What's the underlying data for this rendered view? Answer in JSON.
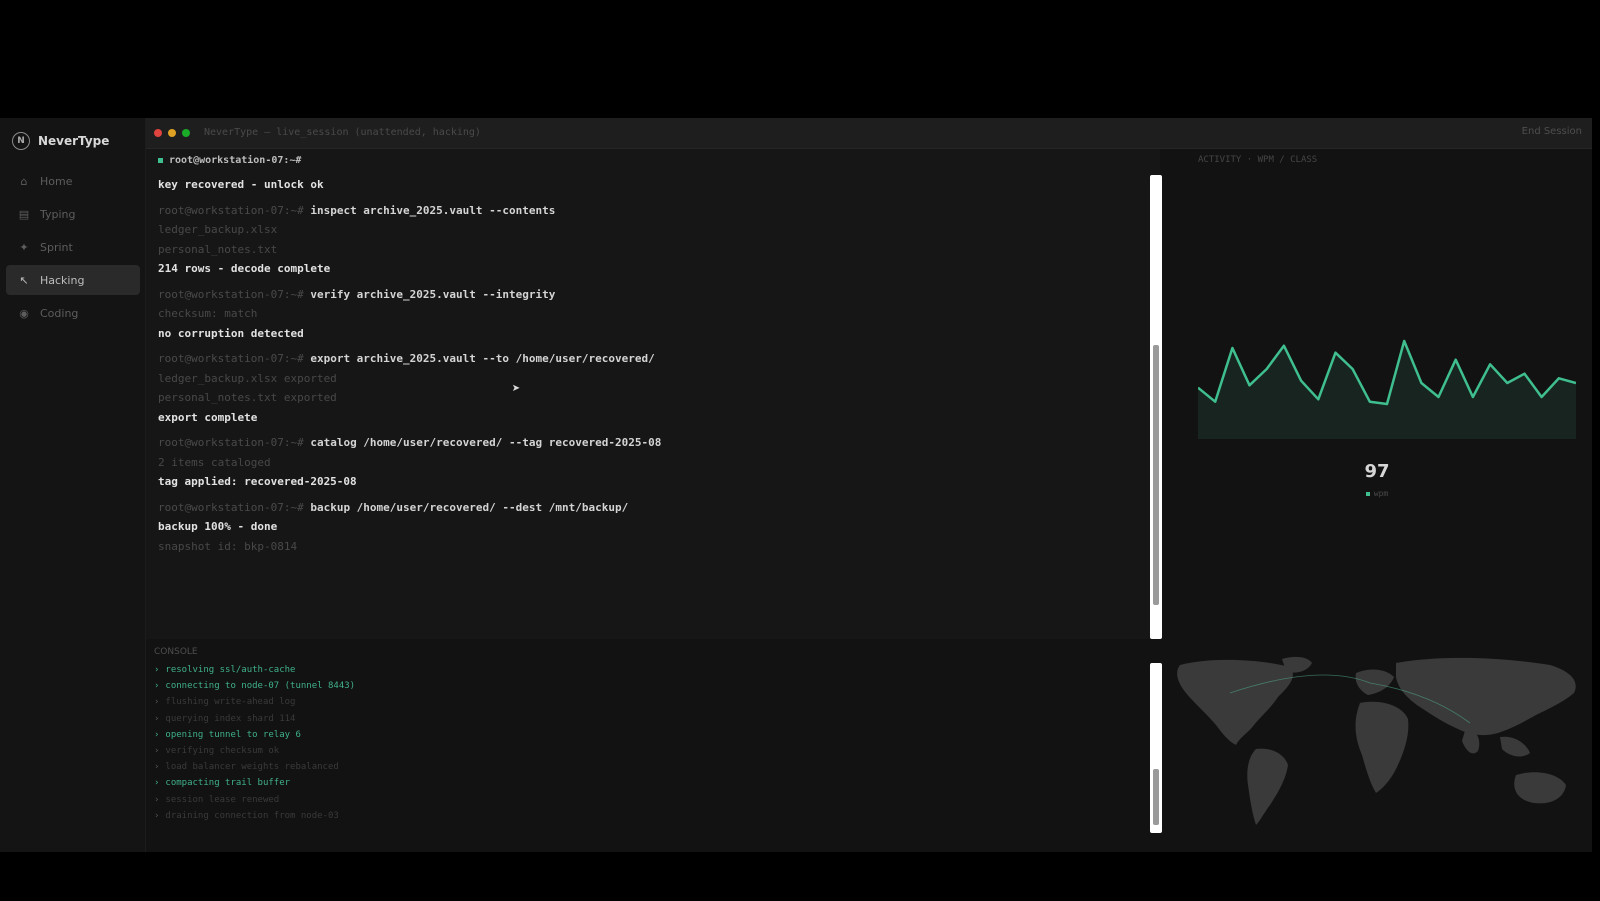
{
  "app": {
    "brand": "NeverType",
    "title": "NeverType — live_session (unattended, hacking)",
    "end_session": "End Session"
  },
  "sidebar": {
    "items": [
      {
        "label": "Home",
        "icon": "home-icon",
        "glyph": "⌂"
      },
      {
        "label": "Typing",
        "icon": "keyboard-icon",
        "glyph": "▤"
      },
      {
        "label": "Sprint",
        "icon": "bolt-icon",
        "glyph": "✦"
      },
      {
        "label": "Hacking",
        "icon": "terminal-icon",
        "glyph": "↖"
      },
      {
        "label": "Coding",
        "icon": "code-icon",
        "glyph": "◉"
      }
    ]
  },
  "terminal": {
    "header": "root@workstation-07:~#",
    "lines": [
      {
        "t": "out",
        "text": "key recovered - unlock ok"
      },
      {
        "t": "cmd",
        "prompt": "root@workstation-07:~# ",
        "text": "inspect archive_2025.vault --contents"
      },
      {
        "t": "dim",
        "text": "ledger_backup.xlsx"
      },
      {
        "t": "dim",
        "text": "personal_notes.txt"
      },
      {
        "t": "out",
        "text": "214 rows - decode complete"
      },
      {
        "t": "cmd",
        "prompt": "root@workstation-07:~# ",
        "text": "verify archive_2025.vault --integrity"
      },
      {
        "t": "dim",
        "text": "checksum: match"
      },
      {
        "t": "out",
        "text": "no corruption detected"
      },
      {
        "t": "cmd",
        "prompt": "root@workstation-07:~# ",
        "text": "export archive_2025.vault --to /home/user/recovered/"
      },
      {
        "t": "dim",
        "text": "ledger_backup.xlsx exported"
      },
      {
        "t": "dim",
        "text": "personal_notes.txt exported"
      },
      {
        "t": "out",
        "text": "export complete"
      },
      {
        "t": "cmd",
        "prompt": "root@workstation-07:~# ",
        "text": "catalog /home/user/recovered/ --tag recovered-2025-08"
      },
      {
        "t": "dim",
        "text": "2 items cataloged"
      },
      {
        "t": "out",
        "text": "tag applied: recovered-2025-08"
      },
      {
        "t": "cmd",
        "prompt": "root@workstation-07:~# ",
        "text": "backup /home/user/recovered/ --dest /mnt/backup/"
      },
      {
        "t": "out",
        "text": "backup 100% - done"
      },
      {
        "t": "dim",
        "text": "snapshot id: bkp-0814"
      }
    ]
  },
  "activity": {
    "label": "ACTIVITY · WPM / CLASS",
    "value": "97",
    "legend": "wpm",
    "accent": "#3fbf8f",
    "series": [
      62,
      56,
      79,
      63,
      70,
      80,
      65,
      57,
      77,
      70,
      56,
      55,
      82,
      64,
      58,
      74,
      58,
      72,
      64,
      68,
      58,
      66,
      64
    ]
  },
  "console": {
    "label": "CONSOLE",
    "lines": [
      {
        "hi": true,
        "text": "resolving ssl/auth-cache"
      },
      {
        "hi": true,
        "text": "connecting to node-07 (tunnel 8443)"
      },
      {
        "hi": false,
        "text": "flushing write-ahead log"
      },
      {
        "hi": false,
        "text": "querying index shard 114"
      },
      {
        "hi": true,
        "text": "opening tunnel to relay 6"
      },
      {
        "hi": false,
        "text": "verifying checksum ok"
      },
      {
        "hi": false,
        "text": "load balancer weights rebalanced"
      },
      {
        "hi": true,
        "text": "compacting trail buffer"
      },
      {
        "hi": false,
        "text": "session lease renewed"
      },
      {
        "hi": false,
        "text": "draining connection from node-03"
      }
    ]
  }
}
